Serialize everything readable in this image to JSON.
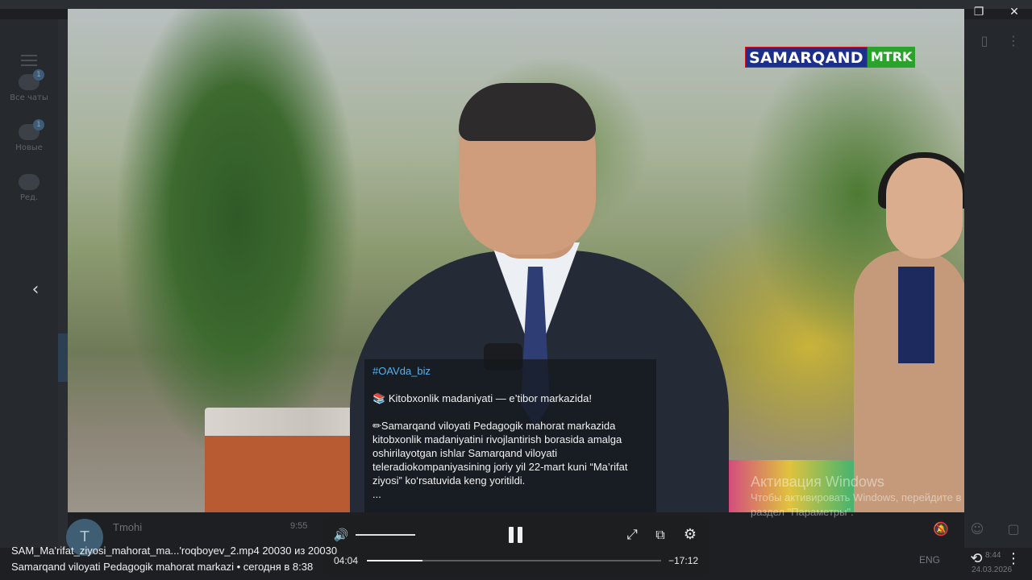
{
  "window": {
    "minimize_icon": "minimize-icon",
    "maximize_icon": "restore-icon",
    "close_icon": "close-icon"
  },
  "background": {
    "folders": [
      {
        "label": "Все чаты",
        "badge": "1"
      },
      {
        "label": "Новые",
        "badge": "1"
      },
      {
        "label": "Ред."
      }
    ],
    "chat": {
      "avatar_letter": "T",
      "name": "Tmohi",
      "time": "9:55"
    },
    "tray": {
      "lang": "ENG",
      "clock": "8:44",
      "date": "24.03.2026"
    }
  },
  "video": {
    "channel_logo": {
      "primary": "SAMARQAND",
      "secondary": "MTRK"
    },
    "caption": {
      "hashtag": "#OAVda_biz",
      "headline_icon": "books-emoji",
      "headline": "Kitobxonlik madaniyati — e’tibor markazida!",
      "body_icon": "pencil-emoji",
      "body_lines": [
        "Samarqand viloyati Pedagogik mahorat markazida",
        "kitobxonlik madaniyatini rivojlantirish borasida amalga",
        "oshirilayotgan ishlar Samarqand viloyati",
        "teleradiokompaniyasining joriy yil 22-mart kuni “Ma’rifat",
        "ziyosi” ko‘rsatuvida keng yoritildi."
      ],
      "more": "..."
    }
  },
  "player": {
    "volume_icon": "volume-icon",
    "volume_level": 1.0,
    "pause_icon": "pause-icon",
    "fullscreen_icon": "fullscreen-icon",
    "pip_icon": "picture-in-picture-icon",
    "settings_icon": "gear-icon",
    "elapsed": "04:04",
    "remaining": "−17:12",
    "progress": 0.19
  },
  "file_info": {
    "title": "SAM_Ma'rifat_ziyosi_mahorat_ma...'roqboyev_2.mp4 20030 из 20030",
    "subtitle": "Samarqand viloyati Pedagogik mahorat markazi • сегодня в 8:38"
  },
  "watermark": {
    "line1": "Активация Windows",
    "line2": "Чтобы активировать Windows, перейдите в",
    "line3": "раздел \"Параметры\"."
  },
  "viewer": {
    "prev_icon": "chevron-left-icon",
    "rotate_icon": "rotate-icon",
    "more_icon": "more-vertical-icon"
  }
}
